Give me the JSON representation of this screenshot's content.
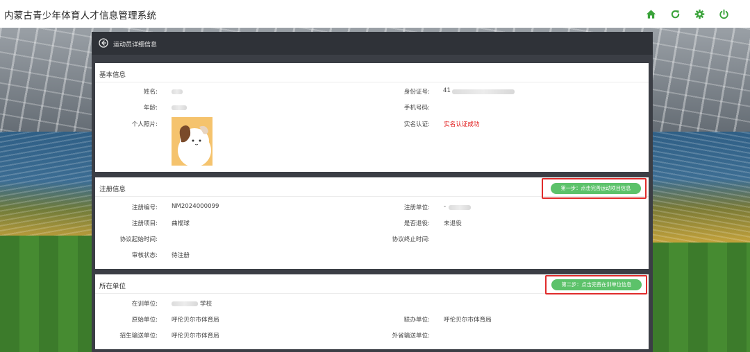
{
  "app": {
    "title": "内蒙古青少年体育人才信息管理系统",
    "icons": [
      "home-icon",
      "refresh-icon",
      "settings-icon",
      "power-icon"
    ],
    "accent": "#3aa33a"
  },
  "panel": {
    "title": "运动员详细信息"
  },
  "basic": {
    "title": "基本信息",
    "name_label": "姓名:",
    "age_label": "年龄:",
    "photo_label": "个人照片:",
    "id_label": "身份证号:",
    "id_value": "41",
    "phone_label": "手机号码:",
    "realname_label": "实名认证:",
    "realname_value": "实名认证成功"
  },
  "registration": {
    "title": "注册信息",
    "step_button": "第一步：点击完善运动项目信息",
    "reg_no_label": "注册编号:",
    "reg_no_value": "NM2024000099",
    "reg_item_label": "注册项目:",
    "reg_item_value": "曲棍球",
    "start_label": "协议起始时间:",
    "status_label": "审核状态:",
    "status_value": "待注册",
    "unit_label": "注册单位:",
    "unit_value": "-",
    "retired_label": "是否退役:",
    "retired_value": "未退役",
    "end_label": "协议终止时间:"
  },
  "unit": {
    "title": "所在单位",
    "step_button": "第二步：点击完善在训单位信息",
    "training_label": "在训单位:",
    "training_value": "学校",
    "origin_label": "原始单位:",
    "origin_value": "呼伦贝尔市体育局",
    "recruit_label": "招生输送单位:",
    "recruit_value": "呼伦贝尔市体育局",
    "joint_label": "联办单位:",
    "joint_value": "呼伦贝尔市体育局",
    "external_label": "外省输送单位:"
  },
  "colors": {
    "step_green": "#5cc26a",
    "highlight_red": "#e02b2b",
    "success_red": "#e01414",
    "header_dark": "#2f3238"
  }
}
